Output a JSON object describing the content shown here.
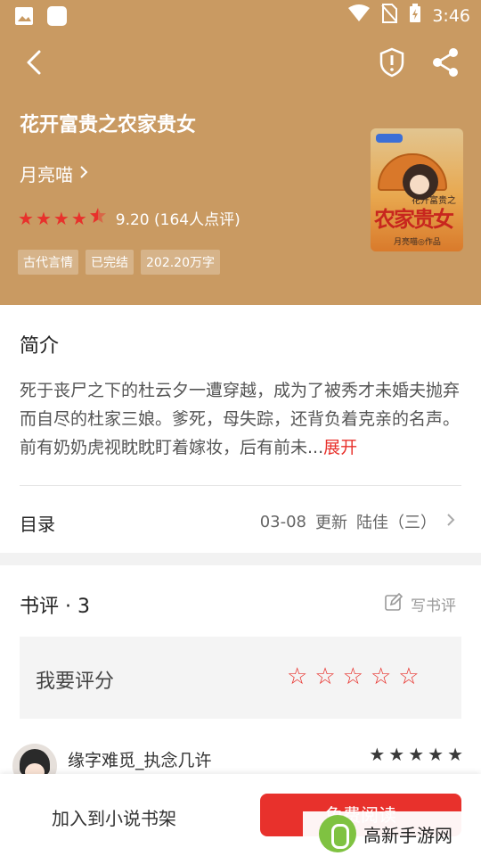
{
  "status_bar": {
    "time": "3:46"
  },
  "book": {
    "title": "花开富贵之农家贵女",
    "author": "月亮喵",
    "rating_text": "9.20 (164人点评)",
    "stars_filled": 4.5,
    "tags": [
      "古代言情",
      "已完结",
      "202.20万字"
    ]
  },
  "cover": {
    "title_text": "农家贵女",
    "subtitle_text": "花开富贵之",
    "author_text": "月亮喵◎作品"
  },
  "intro": {
    "heading": "简介",
    "text": "死于丧尸之下的杜云夕一遭穿越，成为了被秀才未婚夫抛弃而自尽的杜家三娘。爹死，母失踪，还背负着克亲的名声。前有奶奶虎视眈眈盯着嫁妆，后有前未...",
    "more_label": "展开"
  },
  "toc": {
    "label": "目录",
    "date": "03-08",
    "update_label": "更新",
    "latest_chapter": "陆佳（三）"
  },
  "reviews": {
    "heading": "书评 · 3",
    "write_label": "写书评",
    "rate_label": "我要评分",
    "comment_user": "缘字难觅_执念几许",
    "comment_stars": 5
  },
  "bottom": {
    "add_shelf_label": "加入到小说书架",
    "read_label": "免费阅读"
  },
  "watermark": {
    "text": "高新手游网"
  },
  "colors": {
    "header_bg": "#c99a62",
    "accent": "#e8312c"
  }
}
